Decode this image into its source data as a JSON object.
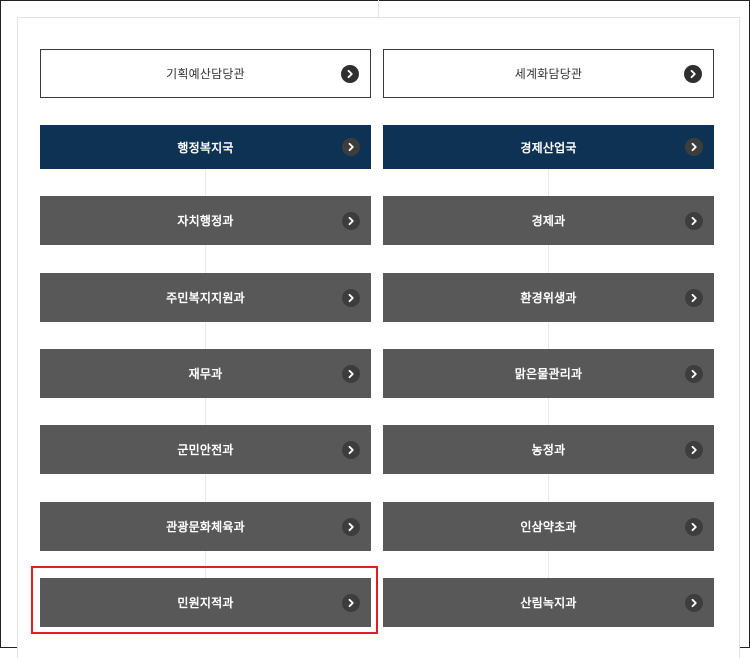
{
  "offices": {
    "left": "기획예산담당관",
    "right": "세계화담당관"
  },
  "bureaus": {
    "left": "행정복지국",
    "right": "경제산업국"
  },
  "departments": {
    "left": [
      "자치행정과",
      "주민복지지원과",
      "재무과",
      "군민안전과",
      "관광문화체육과",
      "민원지적과"
    ],
    "right": [
      "경제과",
      "환경위생과",
      "맑은물관리과",
      "농정과",
      "인삼약초과",
      "산림녹지과"
    ]
  },
  "highlighted_item": "민원지적과",
  "colors": {
    "navy": "#0d3253",
    "gray_button": "#585858",
    "highlight_border": "#e02020"
  },
  "icon": "chevron-right-icon"
}
